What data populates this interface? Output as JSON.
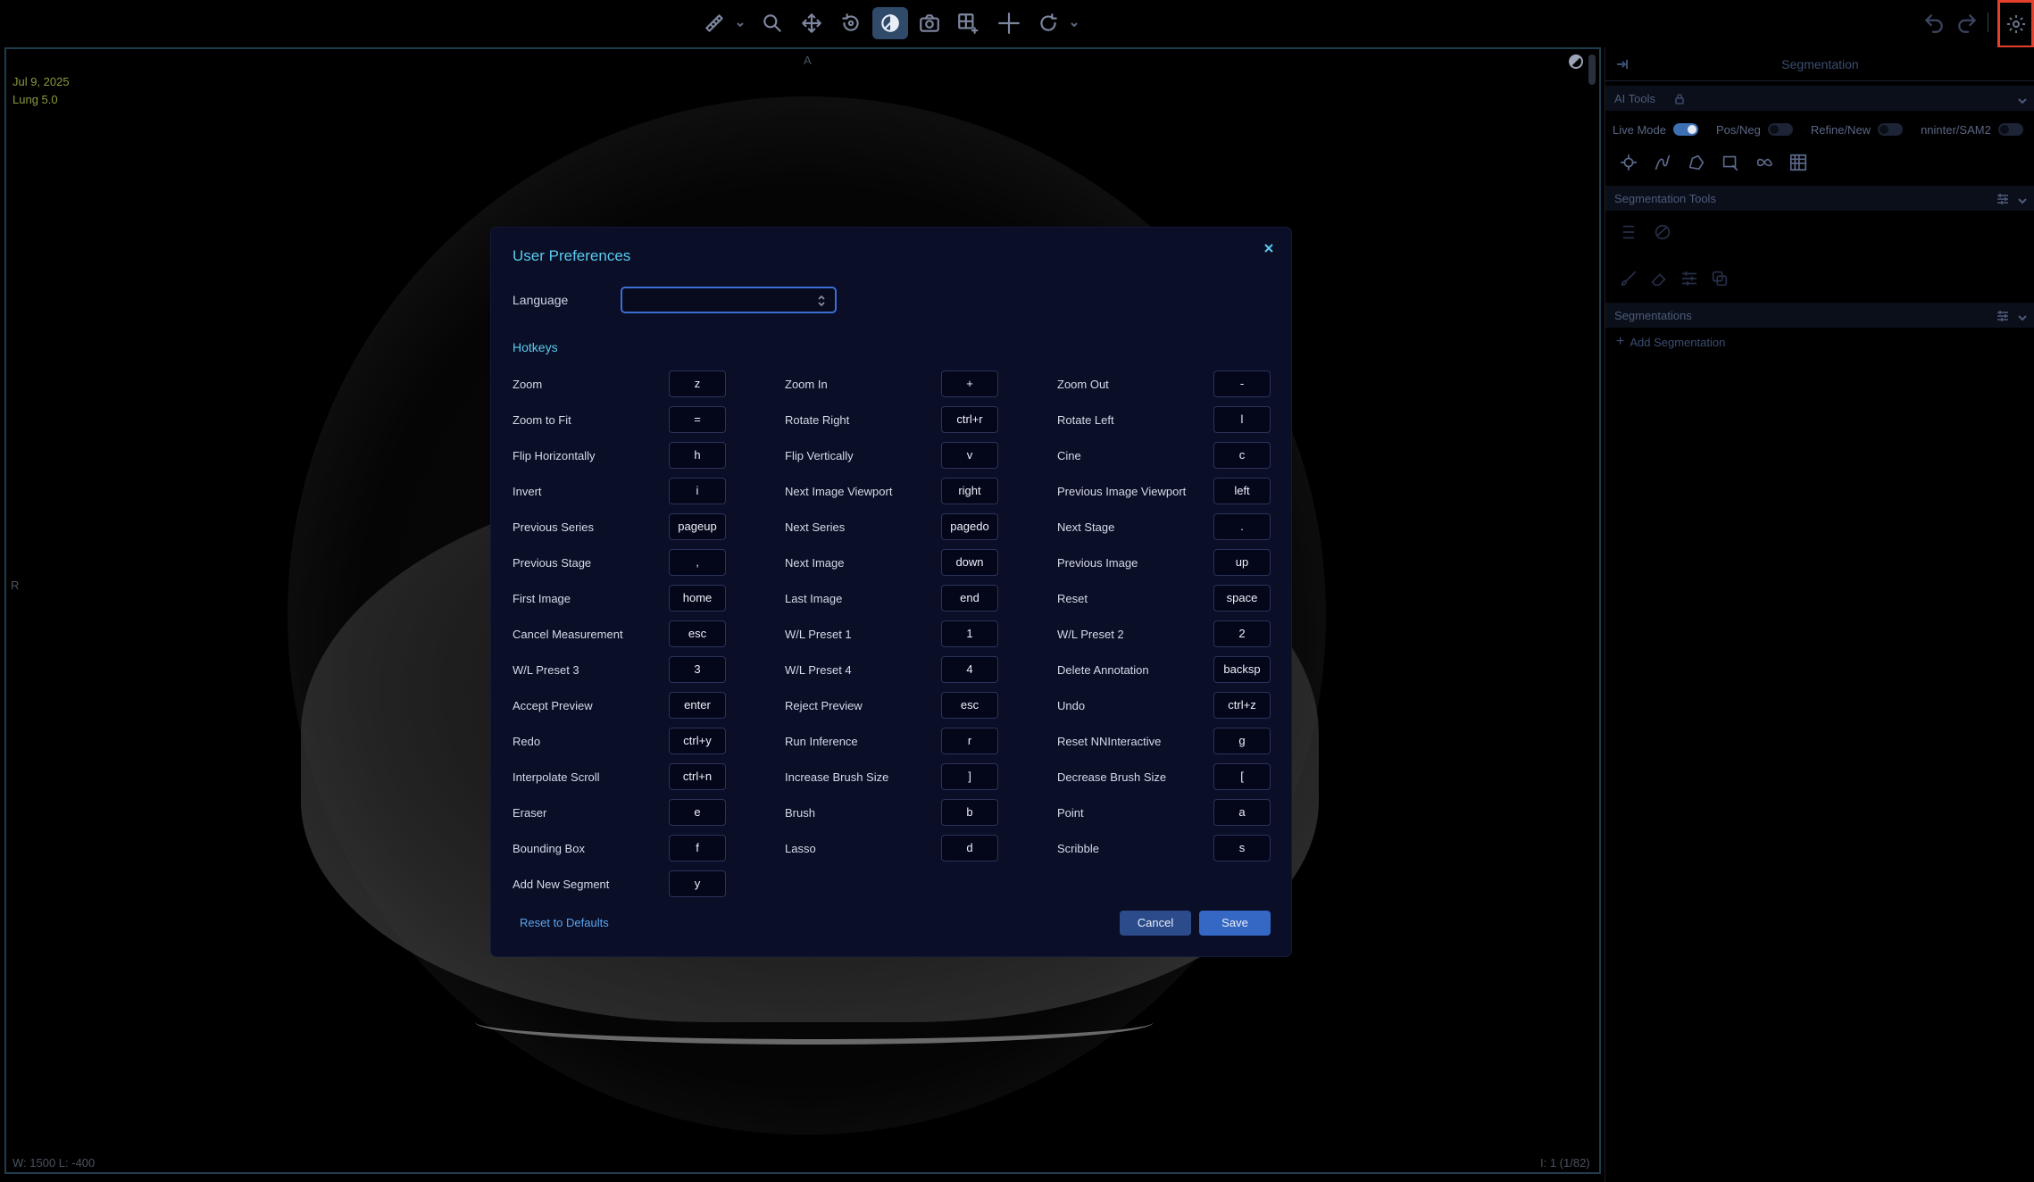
{
  "toolbar": {
    "tools": [
      {
        "name": "measure-icon",
        "active": false
      },
      {
        "name": "zoom-icon",
        "active": false
      },
      {
        "name": "pan-icon",
        "active": false
      },
      {
        "name": "rotate-icon",
        "active": false
      },
      {
        "name": "window-level-icon",
        "active": true
      },
      {
        "name": "capture-icon",
        "active": false
      },
      {
        "name": "layout-icon",
        "active": false
      },
      {
        "name": "crosshairs-icon",
        "active": false
      },
      {
        "name": "reset-view-icon",
        "active": false
      }
    ],
    "undo_icon": "undo-icon",
    "redo_icon": "redo-icon",
    "settings_icon": "gear-icon",
    "settings_highlight_color": "#e5402e"
  },
  "viewport": {
    "date": "Jul 9, 2025",
    "series": "Lung 5.0",
    "orientation_top": "A",
    "orientation_left": "R",
    "window_level": "W: 1500  L: -400",
    "image_index": "I: 1 (1/82)"
  },
  "panel": {
    "title": "Segmentation",
    "ai_tools_label": "AI Tools",
    "toggles": [
      {
        "label": "Live Mode",
        "on": true
      },
      {
        "label": "Pos/Neg",
        "on": false
      },
      {
        "label": "Refine/New",
        "on": false
      },
      {
        "label": "nninter/SAM2",
        "on": false
      }
    ],
    "segmentation_tools_label": "Segmentation Tools",
    "segmentations_label": "Segmentations",
    "add_segmentation": "Add Segmentation"
  },
  "modal": {
    "title": "User Preferences",
    "language_label": "Language",
    "language_value": "",
    "hotkeys_title": "Hotkeys",
    "hotkeys": [
      {
        "label": "Zoom",
        "key": "z"
      },
      {
        "label": "Zoom In",
        "key": "+"
      },
      {
        "label": "Zoom Out",
        "key": "-"
      },
      {
        "label": "Zoom to Fit",
        "key": "="
      },
      {
        "label": "Rotate Right",
        "key": "ctrl+r"
      },
      {
        "label": "Rotate Left",
        "key": "l"
      },
      {
        "label": "Flip Horizontally",
        "key": "h"
      },
      {
        "label": "Flip Vertically",
        "key": "v"
      },
      {
        "label": "Cine",
        "key": "c"
      },
      {
        "label": "Invert",
        "key": "i"
      },
      {
        "label": "Next Image Viewport",
        "key": "right"
      },
      {
        "label": "Previous Image Viewport",
        "key": "left"
      },
      {
        "label": "Previous Series",
        "key": "pageup"
      },
      {
        "label": "Next Series",
        "key": "pagedo"
      },
      {
        "label": "Next Stage",
        "key": "."
      },
      {
        "label": "Previous Stage",
        "key": ","
      },
      {
        "label": "Next Image",
        "key": "down"
      },
      {
        "label": "Previous Image",
        "key": "up"
      },
      {
        "label": "First Image",
        "key": "home"
      },
      {
        "label": "Last Image",
        "key": "end"
      },
      {
        "label": "Reset",
        "key": "space"
      },
      {
        "label": "Cancel Measurement",
        "key": "esc"
      },
      {
        "label": "W/L Preset 1",
        "key": "1"
      },
      {
        "label": "W/L Preset 2",
        "key": "2"
      },
      {
        "label": "W/L Preset 3",
        "key": "3"
      },
      {
        "label": "W/L Preset 4",
        "key": "4"
      },
      {
        "label": "Delete Annotation",
        "key": "backsp"
      },
      {
        "label": "Accept Preview",
        "key": "enter"
      },
      {
        "label": "Reject Preview",
        "key": "esc"
      },
      {
        "label": "Undo",
        "key": "ctrl+z"
      },
      {
        "label": "Redo",
        "key": "ctrl+y"
      },
      {
        "label": "Run Inference",
        "key": "r"
      },
      {
        "label": "Reset NNInteractive",
        "key": "g"
      },
      {
        "label": "Interpolate Scroll",
        "key": "ctrl+n"
      },
      {
        "label": "Increase Brush Size",
        "key": "]"
      },
      {
        "label": "Decrease Brush Size",
        "key": "["
      },
      {
        "label": "Eraser",
        "key": "e"
      },
      {
        "label": "Brush",
        "key": "b"
      },
      {
        "label": "Point",
        "key": "a"
      },
      {
        "label": "Bounding Box",
        "key": "f"
      },
      {
        "label": "Lasso",
        "key": "d"
      },
      {
        "label": "Scribble",
        "key": "s"
      },
      {
        "label": "Add New Segment",
        "key": "y"
      }
    ],
    "reset_label": "Reset to Defaults",
    "cancel_label": "Cancel",
    "save_label": "Save"
  }
}
